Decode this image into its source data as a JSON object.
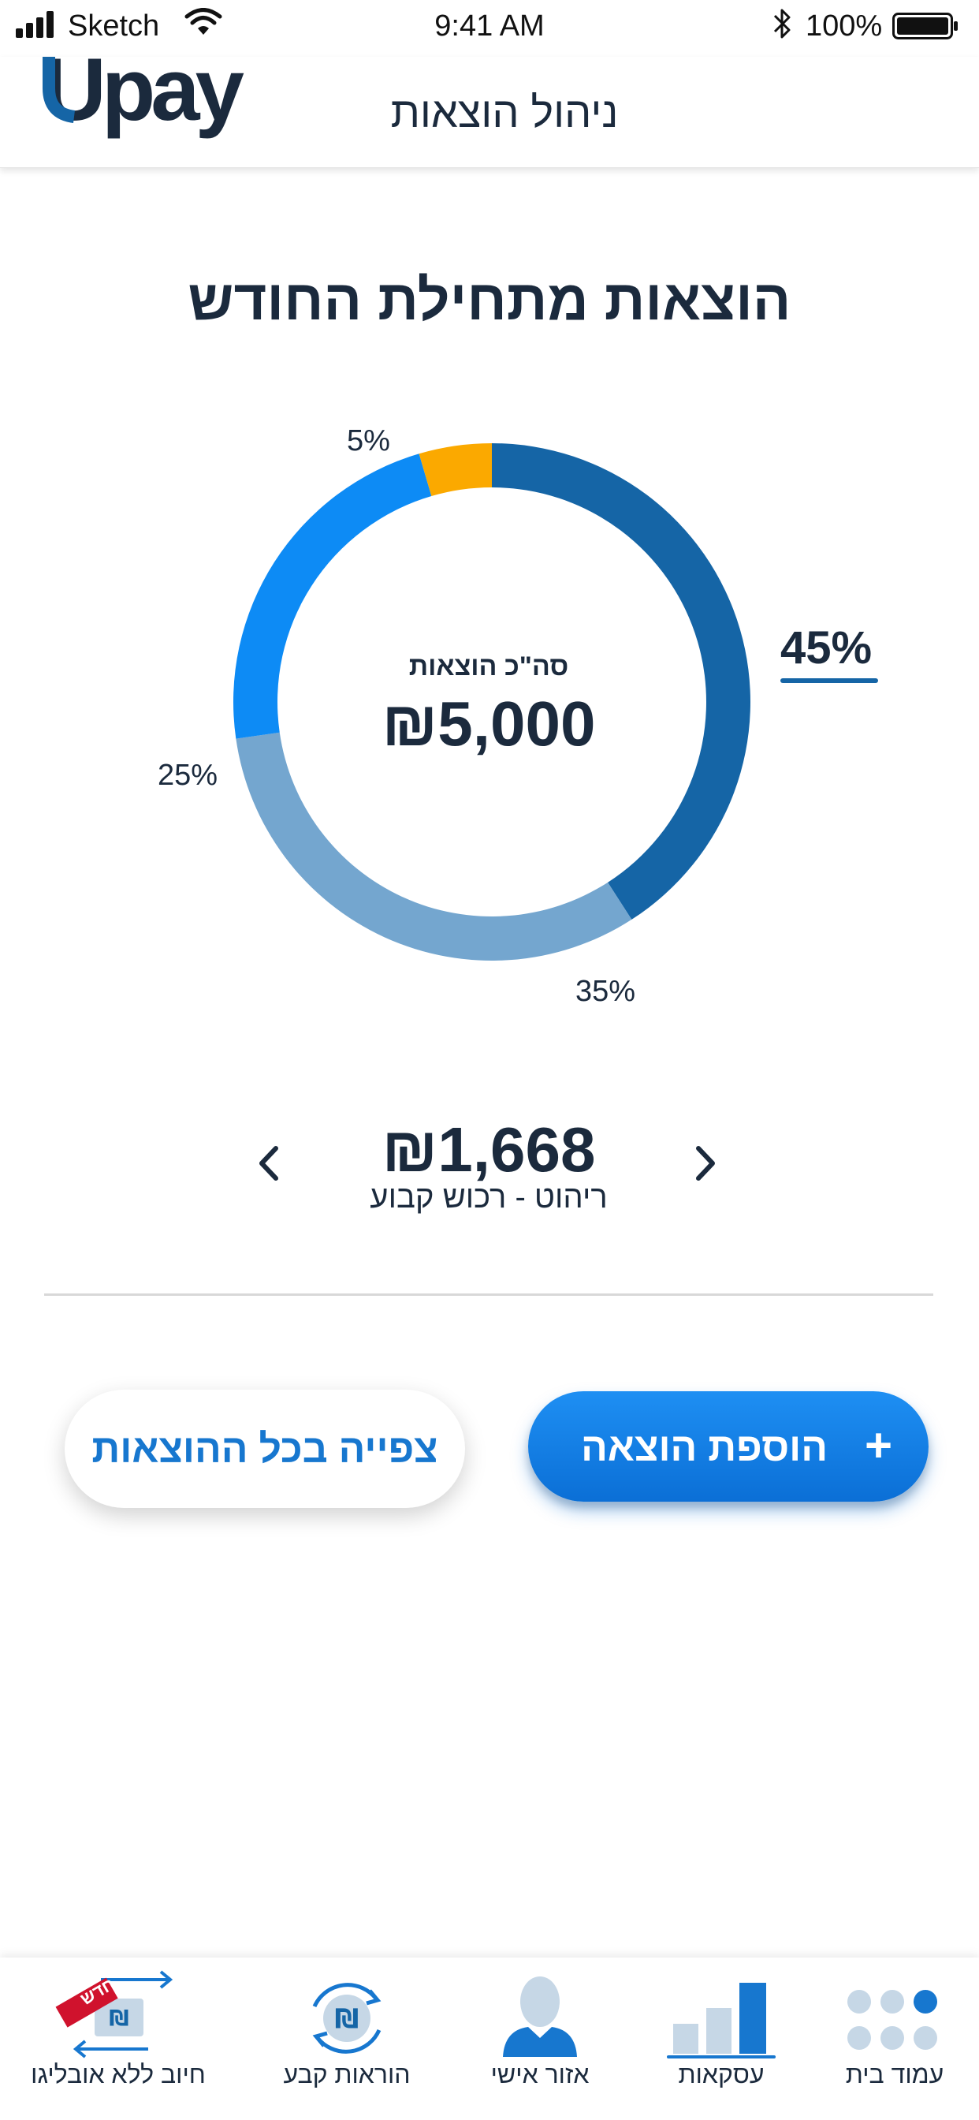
{
  "status_bar": {
    "carrier": "Sketch",
    "time": "9:41 AM",
    "battery": "100%"
  },
  "header": {
    "logo_text": "Upay",
    "title": "ניהול הוצאות"
  },
  "summary": {
    "title": "הוצאות מתחילת החודש",
    "total_label": "סה\"כ הוצאות",
    "total_value": "₪5,000"
  },
  "chart_data": {
    "type": "pie",
    "variant": "donut",
    "slices": [
      {
        "value": 45,
        "label": "45%",
        "color": "#1565a6"
      },
      {
        "value": 35,
        "label": "35%",
        "color": "#74a6cf"
      },
      {
        "value": 25,
        "label": "25%",
        "color": "#0d8bf5"
      },
      {
        "value": 5,
        "label": "5%",
        "color": "#fba900"
      }
    ],
    "highlighted": "45%"
  },
  "category_navigator": {
    "amount": "₪1,668",
    "label": "ריהוט - רכוש קבוע"
  },
  "actions": {
    "add_expense": "הוספת הוצאה",
    "add_icon": "+",
    "view_all": "צפייה בכל ההוצאות"
  },
  "tabbar": {
    "items": [
      {
        "label": "עמוד בית",
        "icon": "home-dots-icon"
      },
      {
        "label": "עסקאות",
        "icon": "bar-chart-icon",
        "active": true
      },
      {
        "label": "אזור אישי",
        "icon": "user-icon"
      },
      {
        "label": "הוראות קבע",
        "icon": "standing-order-icon"
      },
      {
        "label": "חיוב ללא אובליגו",
        "icon": "transfer-icon",
        "badge": "חדש"
      }
    ]
  },
  "colors": {
    "brand_dark": "#1b2a3d",
    "brand_blue": "#1777cf",
    "accent_orange": "#fba900"
  }
}
